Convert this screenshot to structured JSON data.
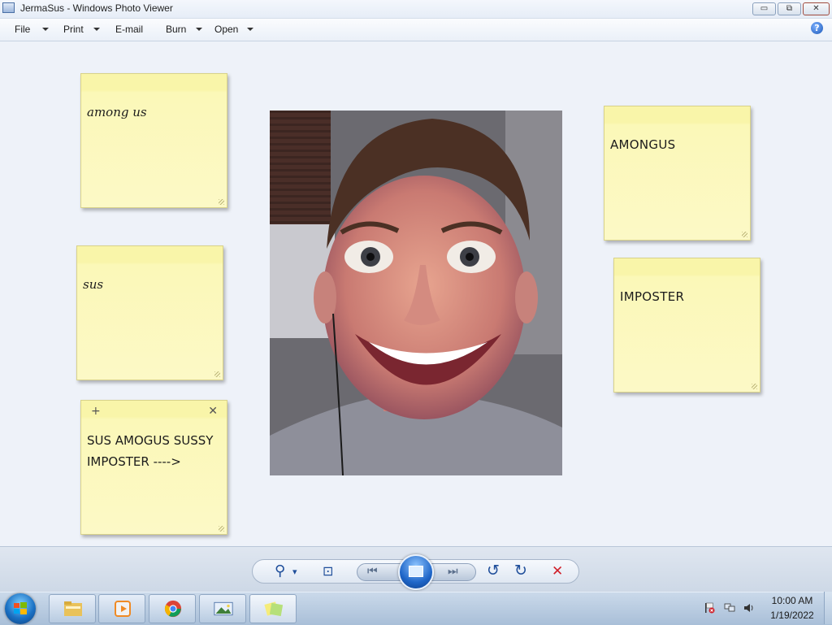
{
  "window": {
    "title": "JermaSus - Windows Photo Viewer",
    "minimize_glyph": "▭",
    "maximize_glyph": "⧉",
    "close_glyph": "✕"
  },
  "menu": {
    "items": [
      {
        "label": "File",
        "has_dropdown": true
      },
      {
        "label": "Print",
        "has_dropdown": true
      },
      {
        "label": "E-mail",
        "has_dropdown": false
      },
      {
        "label": "Burn",
        "has_dropdown": true
      },
      {
        "label": "Open",
        "has_dropdown": true
      }
    ],
    "help_glyph": "?"
  },
  "notes": [
    {
      "text": "among us"
    },
    {
      "text": "sus"
    },
    {
      "text": "SUS AMOGUS SUSSY IMPOSTER ---->",
      "plus_glyph": "+",
      "close_glyph": "✕"
    },
    {
      "text": "AMONGUS"
    },
    {
      "text": "IMPOSTER"
    }
  ],
  "photo": {
    "subject": "close-up face with wide grin"
  },
  "toolbar": {
    "zoom_glyph": "⚲",
    "zoom_dropdown_glyph": "▾",
    "actual_size_glyph": "⊡",
    "prev_glyph": "⏮",
    "next_glyph": "⏭",
    "rotate_ccw_glyph": "↺",
    "rotate_cw_glyph": "↻",
    "delete_glyph": "✕"
  },
  "taskbar": {
    "clock_time": "10:00 AM",
    "clock_date": "1/19/2022",
    "apps": [
      "file-explorer",
      "media-player",
      "chrome",
      "photo-viewer",
      "sticky-notes"
    ]
  },
  "colors": {
    "note_yellow": "#fcf9c6",
    "delete_red": "#d0202a",
    "accent_blue": "#1f4e9a"
  }
}
